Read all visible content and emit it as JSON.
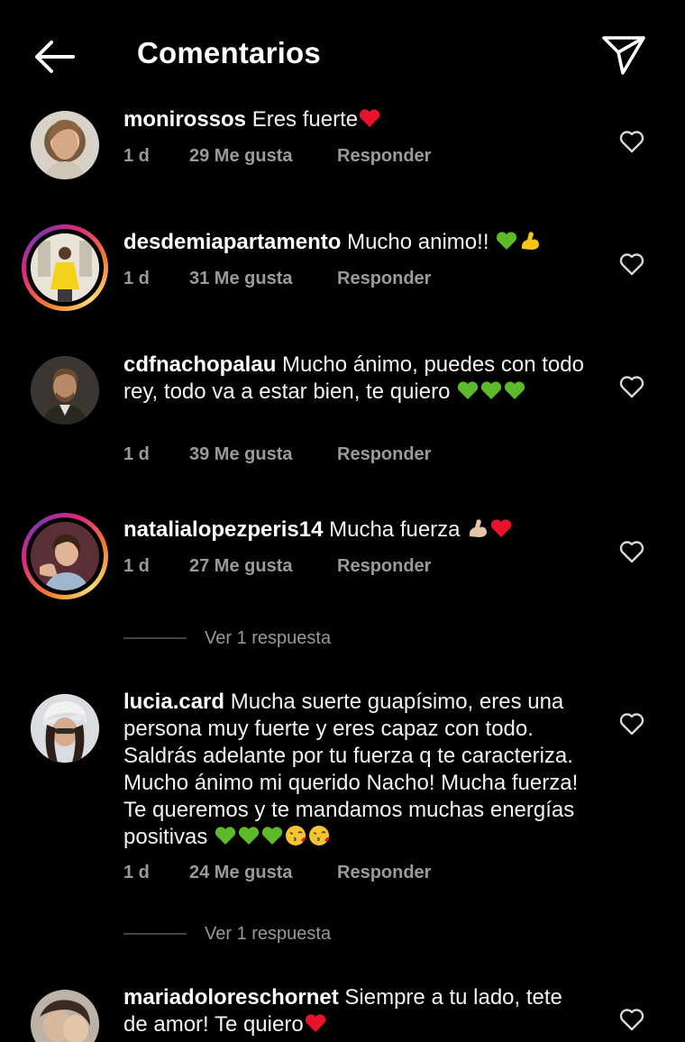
{
  "header": {
    "title": "Comentarios",
    "back_icon": "arrow-left-icon",
    "send_icon": "paper-plane-icon"
  },
  "comments": [
    {
      "username": "monirossos",
      "text": "Eres fuerte",
      "time": "1 d",
      "likes": "29 Me gusta",
      "reply": "Responder"
    },
    {
      "username": "desdemiapartamento",
      "text": "Mucho animo!!",
      "time": "1 d",
      "likes": "31 Me gusta",
      "reply": "Responder"
    },
    {
      "username": "cdfnachopalau",
      "text": "Mucho ánimo, puedes con todo rey, todo va a estar bien, te quiero",
      "time": "1 d",
      "likes": "39 Me gusta",
      "reply": "Responder"
    },
    {
      "username": "natalialopezperis14",
      "text": "Mucha fuerza",
      "time": "1 d",
      "likes": "27 Me gusta",
      "reply": "Responder",
      "view_replies": "Ver 1 respuesta"
    },
    {
      "username": "lucia.card",
      "text": "Mucha suerte guapísimo, eres una persona muy fuerte y eres capaz con todo. Saldrás adelante por tu fuerza q te caracteriza. Mucho ánimo mi querido Nacho! Mucha fuerza! Te queremos y te mandamos muchas energías positivas",
      "time": "1 d",
      "likes": "24 Me gusta",
      "reply": "Responder",
      "view_replies": "Ver 1 respuesta"
    },
    {
      "username": "mariadoloreschornet",
      "text": "Siempre a tu lado, tete de amor! Te quiero"
    }
  ],
  "colors": {
    "background": "#000000",
    "text": "#f2f2f2",
    "muted": "#9a9a9a",
    "heart_red": "#e8132a",
    "green_heart": "#5dbb2a"
  }
}
